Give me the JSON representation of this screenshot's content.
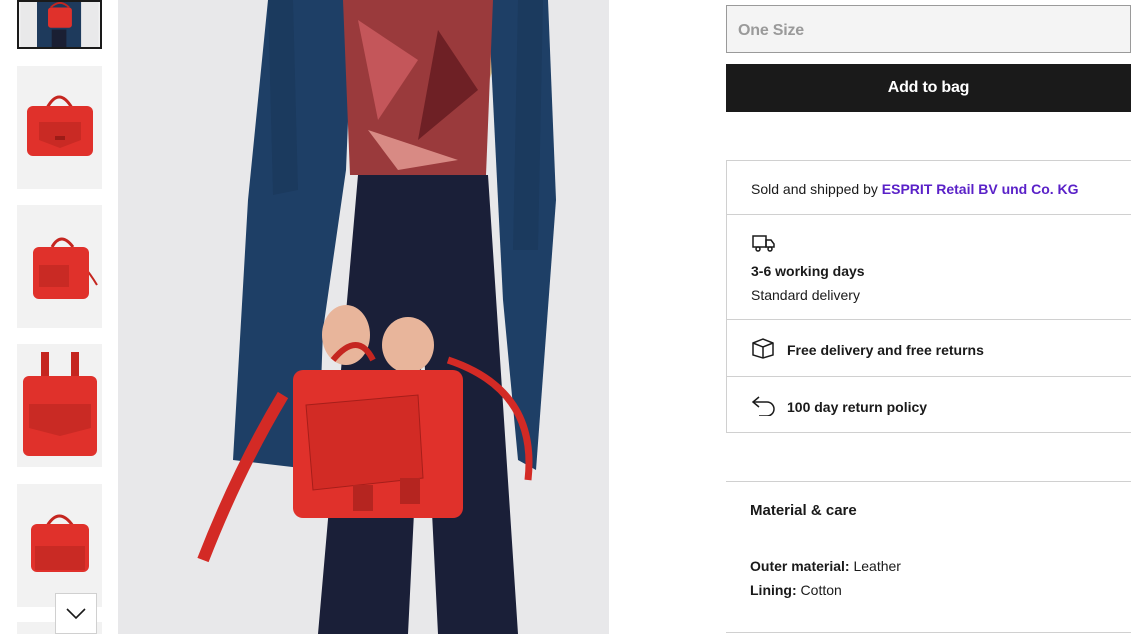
{
  "product": {
    "size_selected": "One Size",
    "add_to_bag_label": "Add to bag"
  },
  "seller": {
    "prefix": "Sold and shipped by",
    "name": "ESPRIT Retail BV und Co. KG"
  },
  "delivery": {
    "time": "3-6 working days",
    "type": "Standard delivery",
    "free_label": "Free delivery and free returns",
    "return_label": "100 day return policy"
  },
  "material_care": {
    "heading": "Material & care",
    "items": [
      {
        "label": "Outer material:",
        "value": "Leather"
      },
      {
        "label": "Lining:",
        "value": "Cotton"
      }
    ]
  },
  "colors": {
    "accent": "#5a21c8",
    "bag_red": "#e0312b",
    "button_bg": "#1a1a1a"
  },
  "icons": [
    "delivery-truck-icon",
    "box-icon",
    "return-arrow-icon",
    "chevron-down-icon"
  ]
}
